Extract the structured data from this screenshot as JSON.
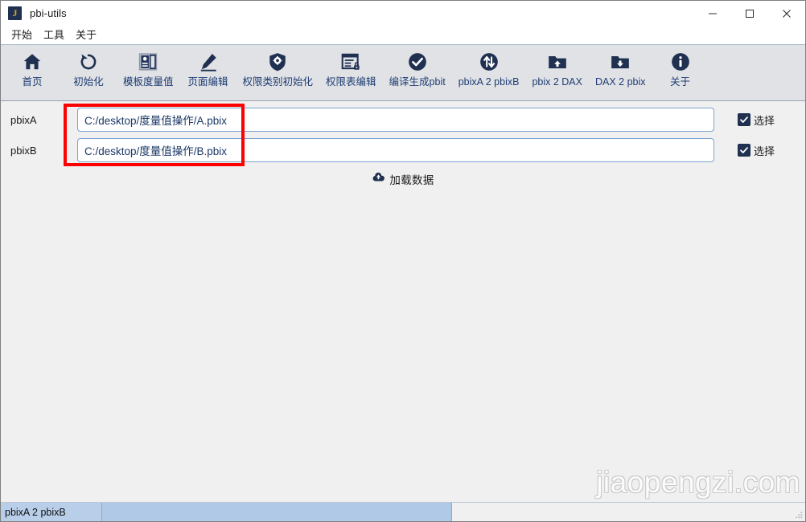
{
  "window": {
    "app_icon_letter": "J",
    "title": "pbi-utils",
    "controls": [
      {
        "name": "minimize",
        "glyph": "—"
      },
      {
        "name": "maximize",
        "glyph": "□"
      },
      {
        "name": "close",
        "glyph": "✕"
      }
    ]
  },
  "menubar": {
    "items": [
      {
        "label": "开始"
      },
      {
        "label": "工具"
      },
      {
        "label": "关于"
      }
    ]
  },
  "toolbar": {
    "items": [
      {
        "icon": "home-icon",
        "label": "首页"
      },
      {
        "icon": "reset-icon",
        "label": "初始化"
      },
      {
        "icon": "template-measure-icon",
        "label": "模板度量值"
      },
      {
        "icon": "pencil-icon",
        "label": "页面编辑"
      },
      {
        "icon": "shield-gear-icon",
        "label": "权限类别初始化"
      },
      {
        "icon": "document-lock-icon",
        "label": "权限表编辑"
      },
      {
        "icon": "check-circle-icon",
        "label": "编译生成pbit"
      },
      {
        "icon": "swap-arrows-icon",
        "label": "pbixA 2 pbixB"
      },
      {
        "icon": "folder-up-icon",
        "label": "pbix 2 DAX"
      },
      {
        "icon": "folder-down-icon",
        "label": "DAX 2 pbix"
      },
      {
        "icon": "info-circle-icon",
        "label": "关于"
      }
    ]
  },
  "form": {
    "rows": [
      {
        "label": "pbixA",
        "value": "C:/desktop/度量值操作/A.pbix",
        "placeholder": "",
        "checkbox_label": "选择",
        "checked": true
      },
      {
        "label": "pbixB",
        "value": "C:/desktop/度量值操作/B.pbix",
        "placeholder": "",
        "checkbox_label": "选择",
        "checked": true
      }
    ],
    "load_button": {
      "icon": "cloud-upload-icon",
      "label": "加载数据"
    }
  },
  "annotation": {
    "shape": "rectangle",
    "color": "#ff0000"
  },
  "watermark": {
    "text": "jiaopengzi.com"
  },
  "statusbar": {
    "mode_label": "pbixA 2 pbixB",
    "progress_value": ""
  },
  "colors": {
    "accent_navy": "#1f3050",
    "toolbar_label": "#1f3d73",
    "toolbar_bg": "#e1e2e6",
    "content_bg": "#f0f0f0",
    "status_blue": "#b9cfe9",
    "annotation_red": "#ff0000",
    "input_border": "#7aa4d0",
    "icon_gold": "#d9a520"
  }
}
